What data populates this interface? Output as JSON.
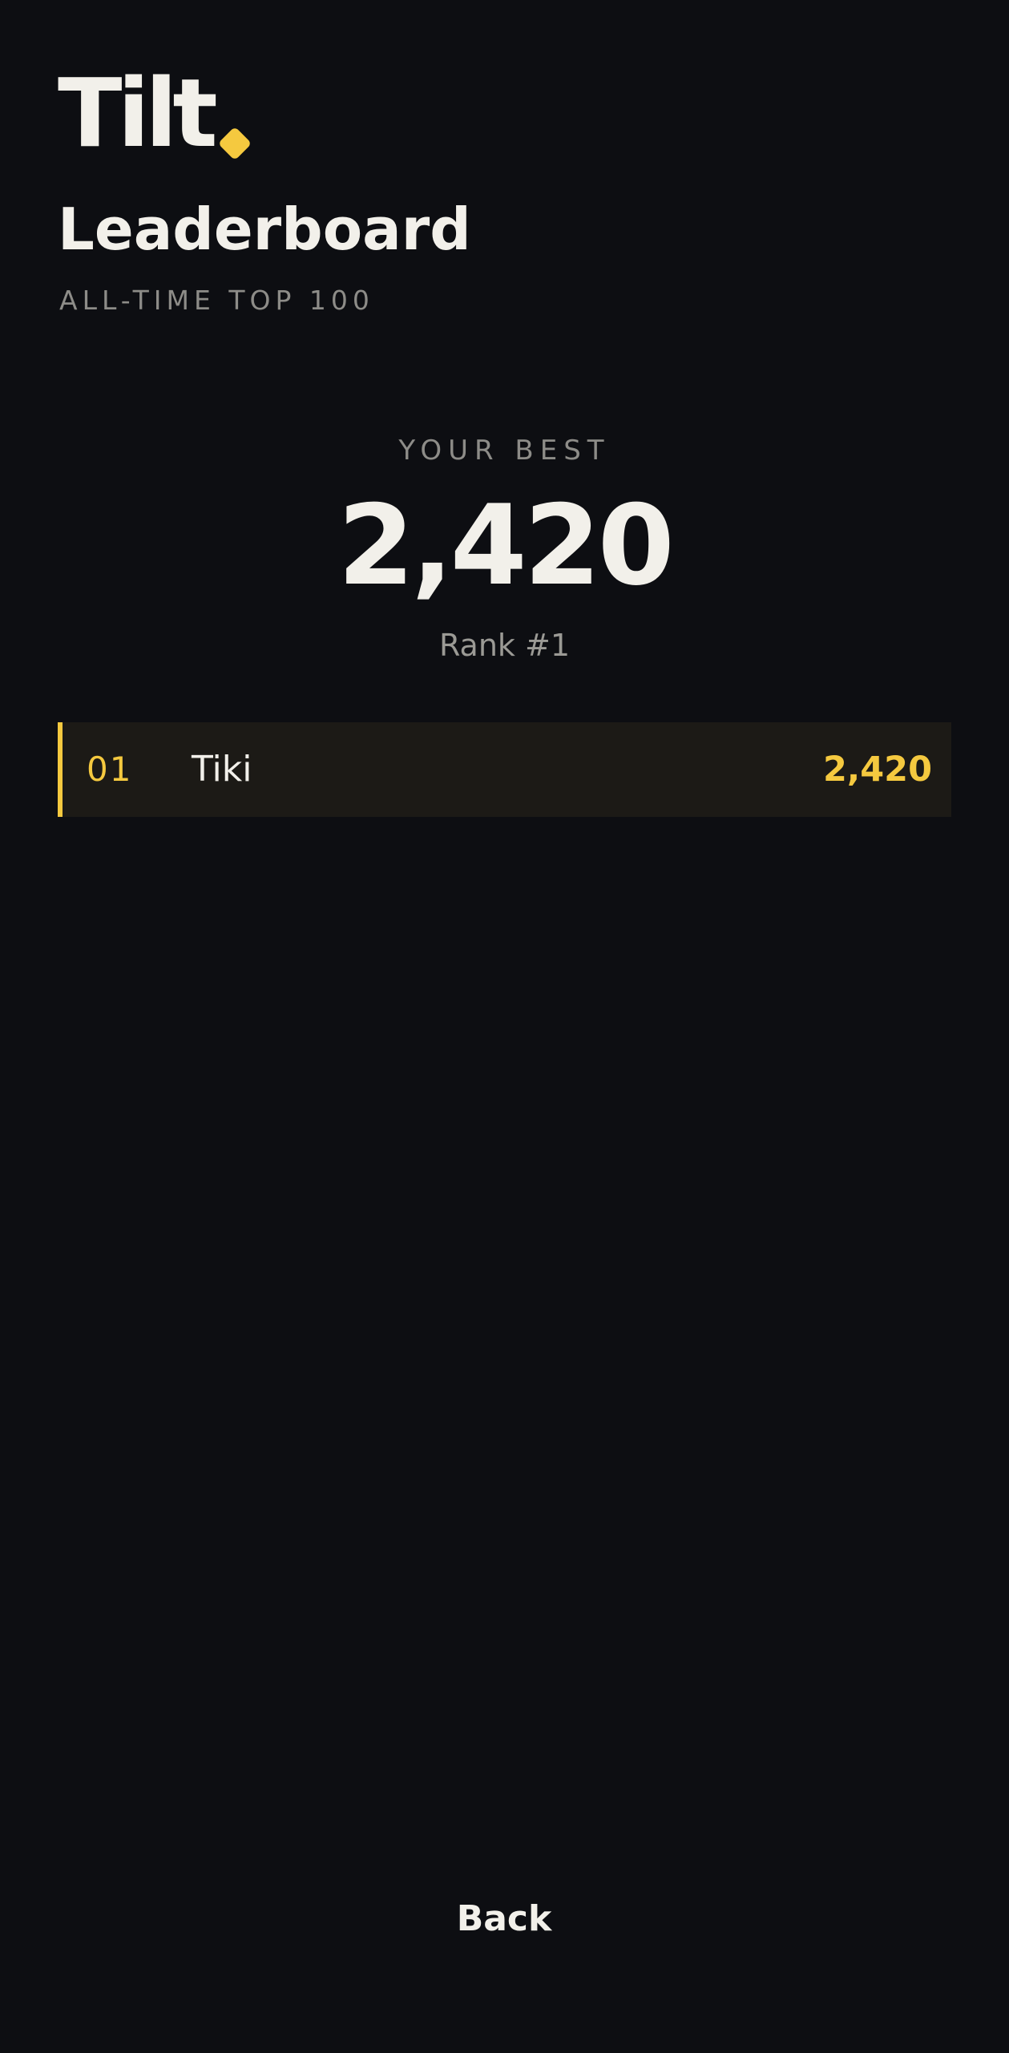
{
  "brand": {
    "logo_text": "Tilt",
    "accent_color": "#f5c93f"
  },
  "header": {
    "title": "Leaderboard",
    "subtitle": "ALL-TIME TOP 100"
  },
  "best": {
    "label": "YOUR BEST",
    "score": "2,420",
    "rank": "Rank #1"
  },
  "leaderboard": {
    "rows": [
      {
        "rank": "01",
        "name": "Tiki",
        "score": "2,420",
        "highlighted": true
      }
    ]
  },
  "footer": {
    "back_label": "Back"
  }
}
